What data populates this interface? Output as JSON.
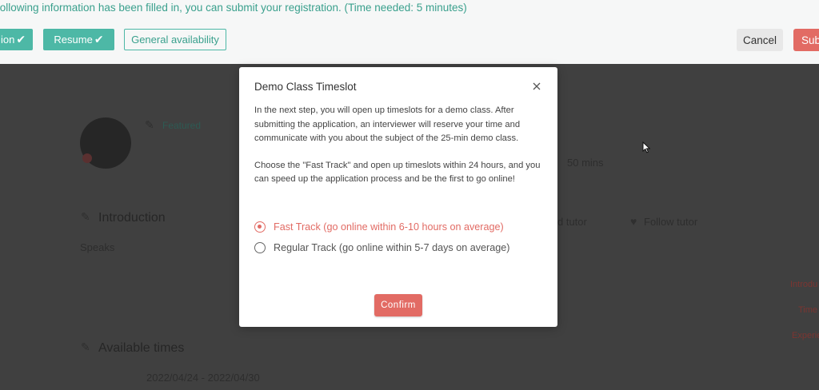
{
  "topbar": {
    "notice": "following information has been filled in, you can submit your registration. (Time needed: 5 minutes)",
    "buttons": [
      {
        "label": "ion"
      },
      {
        "label": "Resume"
      },
      {
        "label": "General availability"
      }
    ],
    "cancel_label": "Cancel",
    "submit_label": "Sub"
  },
  "background": {
    "profile_link": "Featured",
    "lesson_duration": "50 mins",
    "introduction_heading": "Introduction",
    "speaks_label": "Speaks",
    "follow_tutor": "Follow tutor",
    "tutor_action": "d tutor",
    "available_times_heading": "Available times",
    "date_range": "2022/04/24 - 2022/04/30",
    "side_nav": [
      "Introdu",
      "Time",
      "Experie"
    ]
  },
  "modal": {
    "title": "Demo Class Timeslot",
    "paragraph1": "In the next step, you will open up timeslots for a demo class. After submitting the application, an interviewer will reserve your time and communicate with you about the subject of the 25-min demo class.",
    "paragraph2": "Choose the \"Fast Track\" and open up timeslots within 24 hours, and you can speed up the application process and be the first to go online!",
    "options": [
      {
        "label": "Fast Track (go online within 6-10 hours on average)",
        "selected": true
      },
      {
        "label": "Regular Track (go online within 5-7 days on average)",
        "selected": false
      }
    ],
    "confirm_label": "Confirm"
  },
  "icons": {
    "close": "close-icon",
    "check": "check-icon",
    "pencil": "pencil-icon",
    "heart": "heart-icon",
    "cursor": "mouse-pointer-icon"
  },
  "colors": {
    "accent": "#4db8a6",
    "primary": "#e26b64",
    "overlay": "#404040"
  }
}
